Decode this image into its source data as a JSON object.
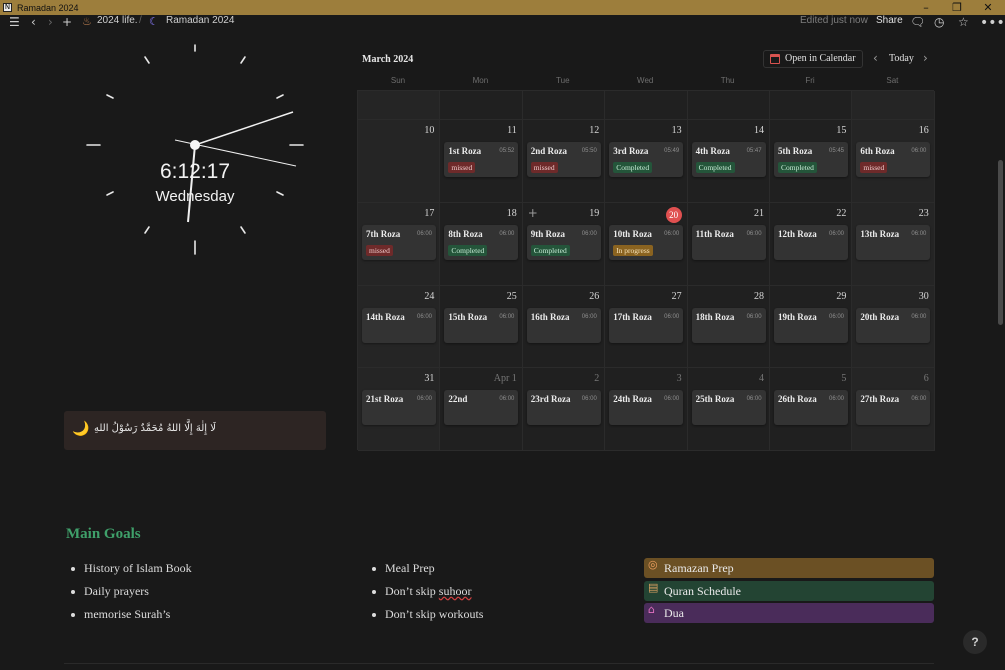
{
  "window": {
    "title": "Ramadan 2024",
    "app_icon": "N"
  },
  "topbar": {
    "breadcrumb_parent": "2024 life.",
    "breadcrumb_sep": "/",
    "breadcrumb_current": "Ramadan 2024",
    "edited": "Edited just now",
    "share": "Share",
    "icons": [
      "menu-icon",
      "back-icon",
      "forward-icon",
      "add-icon",
      "comment-icon",
      "history-icon",
      "star-icon",
      "more-icon"
    ]
  },
  "clock": {
    "time": "6:12:17",
    "day": "Wednesday"
  },
  "callout": {
    "icon": "crescent-moon-icon",
    "text": "لَا إِلٰهَ إِلَّا اللهُ مُحَمَّدٌ رَسُوْلُ اللهِ"
  },
  "calendar": {
    "month": "March 2024",
    "open_in_calendar": "Open in Calendar",
    "today": "Today",
    "weekdays": [
      "Sun",
      "Mon",
      "Tue",
      "Wed",
      "Thu",
      "Fri",
      "Sat"
    ],
    "accent_today": "#e05050",
    "weeks": [
      [
        {
          "day": ""
        },
        {
          "day": ""
        },
        {
          "day": ""
        },
        {
          "day": ""
        },
        {
          "day": ""
        },
        {
          "day": ""
        },
        {
          "day": ""
        }
      ],
      [
        {
          "day": "10"
        },
        {
          "day": "11",
          "title": "1st Roza",
          "time": "05:52",
          "status": "missed"
        },
        {
          "day": "12",
          "title": "2nd Roza",
          "time": "05:50",
          "status": "missed"
        },
        {
          "day": "13",
          "title": "3rd Roza",
          "time": "05:49",
          "status": "Completed"
        },
        {
          "day": "14",
          "title": "4th Roza",
          "time": "05:47",
          "status": "Completed"
        },
        {
          "day": "15",
          "title": "5th Roza",
          "time": "05:45",
          "status": "Completed"
        },
        {
          "day": "16",
          "title": "6th Roza",
          "time": "06:00",
          "status": "missed"
        }
      ],
      [
        {
          "day": "17",
          "title": "7th Roza",
          "time": "06:00",
          "status": "missed"
        },
        {
          "day": "18",
          "title": "8th Roza",
          "time": "06:00",
          "status": "Completed"
        },
        {
          "day": "19",
          "title": "9th Roza",
          "time": "06:00",
          "status": "Completed",
          "plus": "+"
        },
        {
          "day": "20",
          "title": "10th Roza",
          "time": "06:00",
          "status": "In progress",
          "today": true
        },
        {
          "day": "21",
          "title": "11th Roza",
          "time": "06:00"
        },
        {
          "day": "22",
          "title": "12th Roza",
          "time": "06:00"
        },
        {
          "day": "23",
          "title": "13th Roza",
          "time": "06:00"
        }
      ],
      [
        {
          "day": "24",
          "title": "14th Roza",
          "time": "06:00"
        },
        {
          "day": "25",
          "title": "15th Roza",
          "time": "06:00"
        },
        {
          "day": "26",
          "title": "16th Roza",
          "time": "06:00"
        },
        {
          "day": "27",
          "title": "17th Roza",
          "time": "06:00"
        },
        {
          "day": "28",
          "title": "18th Roza",
          "time": "06:00"
        },
        {
          "day": "29",
          "title": "19th Roza",
          "time": "06:00"
        },
        {
          "day": "30",
          "title": "20th Roza",
          "time": "06:00"
        }
      ],
      [
        {
          "day": "31",
          "title": "21st Roza",
          "time": "06:00"
        },
        {
          "day": "Apr 1",
          "title": "22nd",
          "time": "06:00",
          "dim": true
        },
        {
          "day": "2",
          "title": "23rd Roza",
          "time": "06:00",
          "dim": true
        },
        {
          "day": "3",
          "title": "24th Roza",
          "time": "06:00",
          "dim": true
        },
        {
          "day": "4",
          "title": "25th Roza",
          "time": "06:00",
          "dim": true
        },
        {
          "day": "5",
          "title": "26th Roza",
          "time": "06:00",
          "dim": true
        },
        {
          "day": "6",
          "title": "27th Roza",
          "time": "06:00",
          "dim": true
        }
      ]
    ]
  },
  "goals": {
    "title": "Main Goals",
    "col1": [
      "History of Islam Book",
      "Daily prayers",
      "memorise Surah’s"
    ],
    "col2_item1": "Meal Prep",
    "col2_item2_prefix": "Don’t skip ",
    "col2_item2_marked": "suhoor",
    "col2_item3": "Don’t skip workouts"
  },
  "links": [
    {
      "label": "Ramazan Prep",
      "icon": "target-icon",
      "color": "#6b5024"
    },
    {
      "label": "Quran Schedule",
      "icon": "book-icon",
      "color": "#234433"
    },
    {
      "label": "Dua",
      "icon": "mosque-icon",
      "color": "#4a2c5a"
    }
  ],
  "help": "?"
}
